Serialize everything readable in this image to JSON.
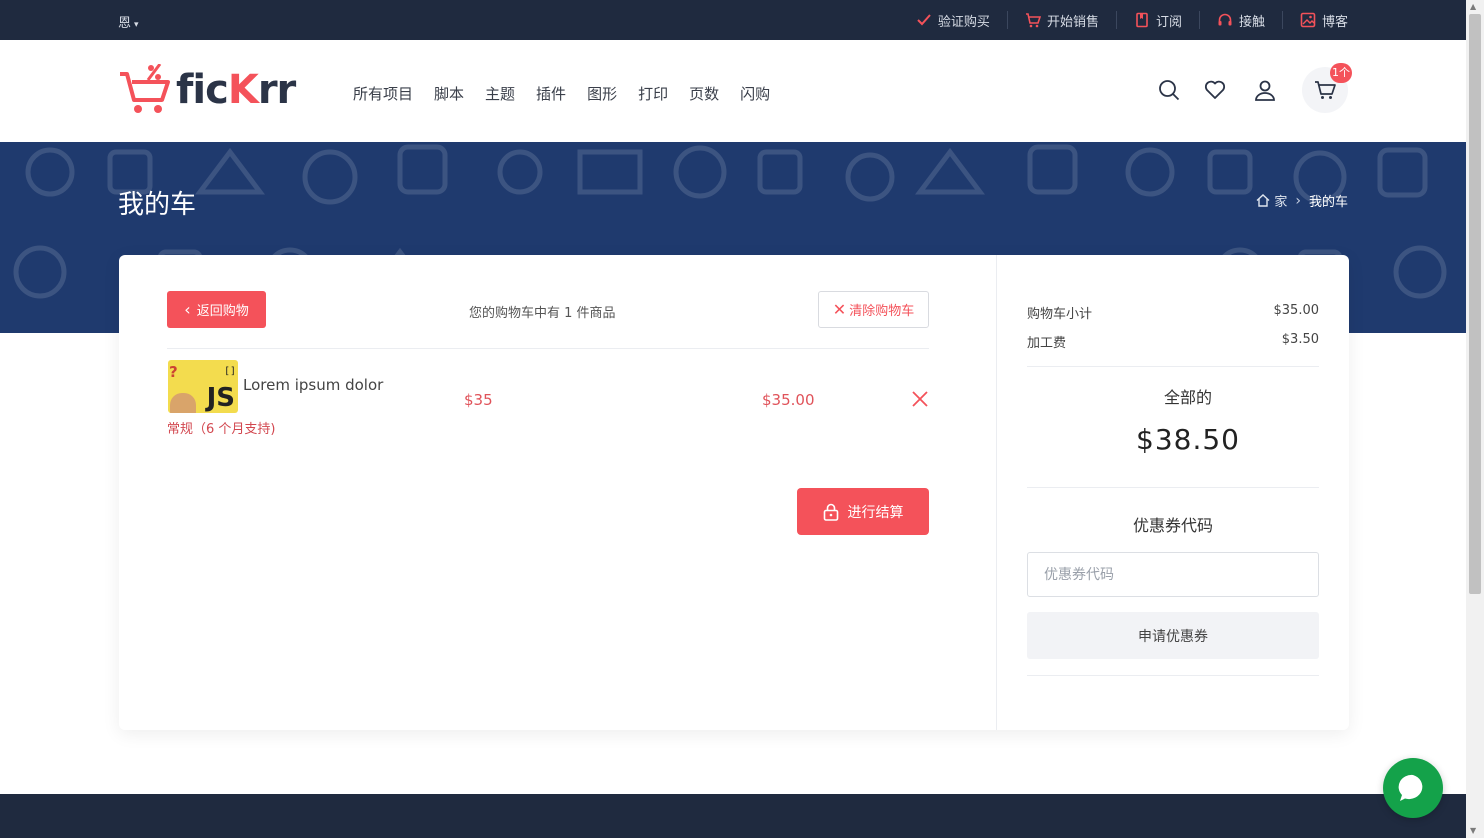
{
  "topbar": {
    "language": "恩",
    "links": [
      {
        "label": "验证购买",
        "icon": "check-icon"
      },
      {
        "label": "开始销售",
        "icon": "cart-icon"
      },
      {
        "label": "订阅",
        "icon": "bookmark-icon"
      },
      {
        "label": "接触",
        "icon": "headset-icon"
      },
      {
        "label": "博客",
        "icon": "image-icon"
      }
    ]
  },
  "header": {
    "logo": {
      "part1": "fic",
      "part2": "K",
      "part3": "rr"
    },
    "nav": [
      "所有项目",
      "脚本",
      "主题",
      "插件",
      "图形",
      "打印",
      "页数",
      "闪购"
    ],
    "cart_badge": "1个"
  },
  "hero": {
    "title": "我的车",
    "breadcrumb": {
      "home": "家",
      "current": "我的车"
    }
  },
  "cart": {
    "back_label": "返回购物",
    "count_text": "您的购物车中有 1 件商品",
    "clear_label": "清除购物车",
    "items": [
      {
        "name": "Lorem ipsum dolor",
        "license": "常规（6 个月支持)",
        "price": "$35",
        "total": "$35.00",
        "thumb_label": "JS"
      }
    ],
    "checkout_label": "进行结算"
  },
  "summary": {
    "subtotal_label": "购物车小计",
    "subtotal_value": "$35.00",
    "fee_label": "加工费",
    "fee_value": "$3.50",
    "total_label": "全部的",
    "total_value": "$38.50",
    "coupon_title": "优惠券代码",
    "coupon_placeholder": "优惠券代码",
    "coupon_value": "",
    "coupon_button": "申请优惠券"
  },
  "colors": {
    "accent": "#f4525a",
    "dark": "#1f2a3f",
    "hero": "#1f3a6e",
    "chat": "#14a24a"
  }
}
